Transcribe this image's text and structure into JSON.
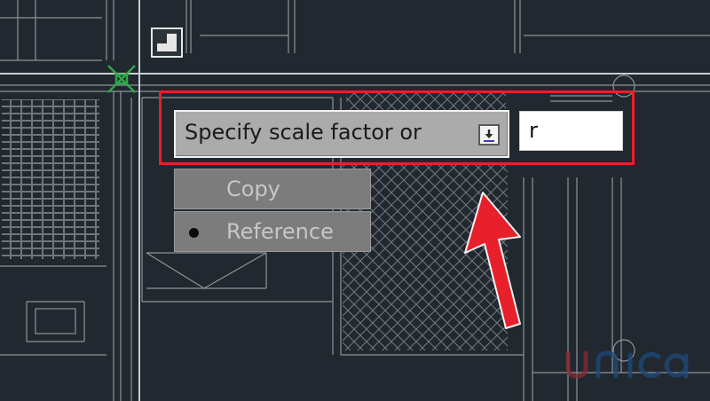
{
  "command_prompt": {
    "text": "Specify scale factor or",
    "dropdown_icon": "dropdown-arrow-icon"
  },
  "dynamic_input": {
    "value": "r"
  },
  "options_menu": {
    "items": [
      {
        "label": "Copy",
        "selected": false
      },
      {
        "label": "Reference",
        "selected": true
      }
    ]
  },
  "annotation": {
    "highlight_color": "#e8202b",
    "arrow_color": "#e8202b"
  },
  "watermark": {
    "text": "unica",
    "colors": [
      "#8a2a30",
      "#1e4a7a"
    ]
  },
  "canvas": {
    "background": "#212830",
    "line_color": "#9aa0a4",
    "crosshair_color": "#c9ced1",
    "ucs_marker_color": "#2fa84a"
  }
}
